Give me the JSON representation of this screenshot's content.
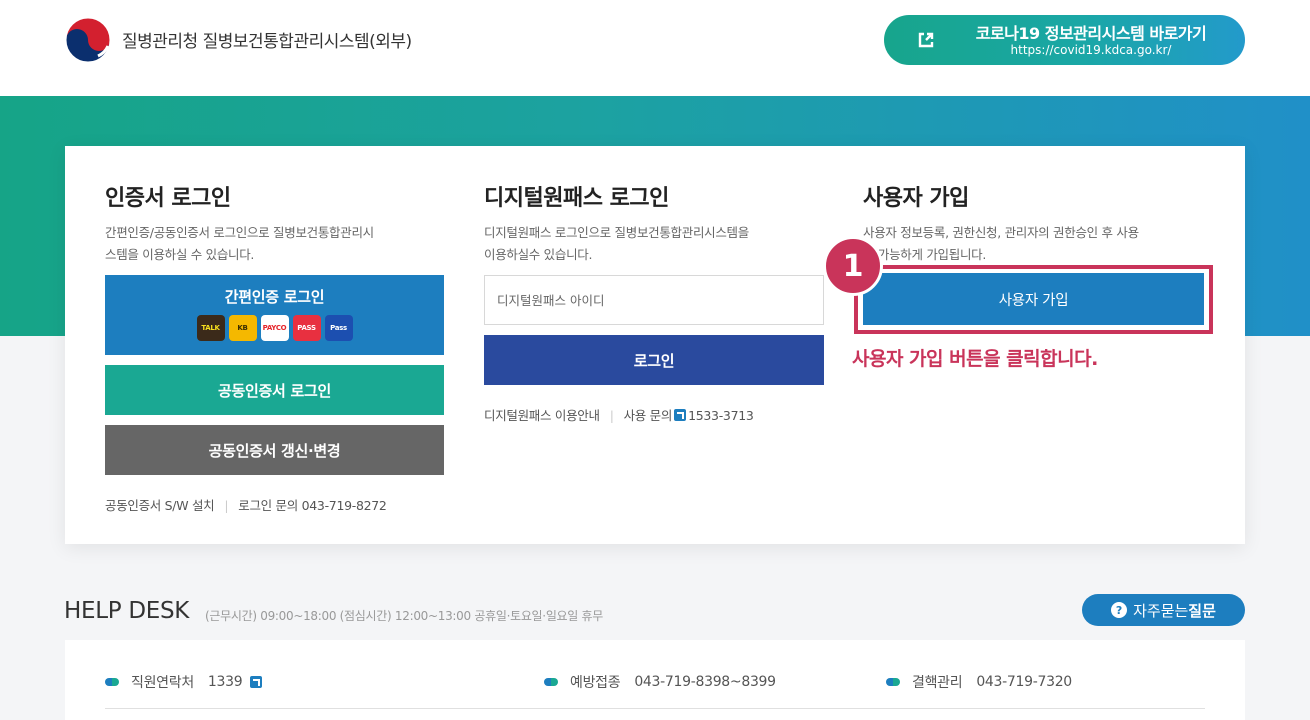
{
  "header": {
    "site_title": "질병관리청 질병보건통합관리시스템(외부)",
    "covid_link": {
      "title": "코로나19 정보관리시스템 바로가기",
      "url_text": "https://covid19.kdca.go.kr/"
    }
  },
  "cert_login": {
    "title": "인증서 로그인",
    "desc_line1": "간편인증/공동인증서 로그인으로 질병보건통합관리시",
    "desc_line2": "스템을 이용하실 수 있습니다.",
    "simple_auth_label": "간편인증 로그인",
    "simple_auth_icons": [
      "TALK",
      "KB",
      "PAYCO",
      "PASS",
      "Pass"
    ],
    "joint_cert_label": "공동인증서 로그인",
    "renew_label": "공동인증서 갱신·변경",
    "sw_install": "공동인증서 S/W 설치",
    "login_inquiry": "로그인 문의 043-719-8272"
  },
  "digital_onepass": {
    "title": "디지털원패스 로그인",
    "desc_line1": "디지털원패스 로그인으로 질병보건통합관리시스템을",
    "desc_line2": "이용하실수 있습니다.",
    "id_placeholder": "디지털원패스 아이디",
    "login_label": "로그인",
    "guide": "디지털원패스 이용안내",
    "inquiry_label": "사용 문의",
    "inquiry_phone": "1533-3713"
  },
  "signup": {
    "title": "사용자 가입",
    "desc_line1": "사용자 정보등록, 권한신청, 관리자의 권한승인 후 사용",
    "desc_line2": "이 가능하게 가입됩니다.",
    "button_label": "사용자 가입",
    "step_number": "1",
    "instruction": "사용자 가입 버튼을 클릭합니다."
  },
  "help_desk": {
    "title": "HELP DESK",
    "hours": "(근무시간) 09:00~18:00 (점심시간) 12:00~13:00 공휴일·토요일·일요일 휴무",
    "faq_prefix": "자주묻는",
    "faq_bold": "질문",
    "contacts": [
      {
        "label": "직원연락처",
        "number": "1339"
      },
      {
        "label": "예방접종",
        "number": "043-719-8398~8399"
      },
      {
        "label": "결핵관리",
        "number": "043-719-7320"
      }
    ]
  },
  "colors": {
    "accent_blue": "#1d7ebf",
    "accent_green": "#1aa893",
    "navy": "#2a4a9e",
    "highlight": "#c9345a"
  }
}
